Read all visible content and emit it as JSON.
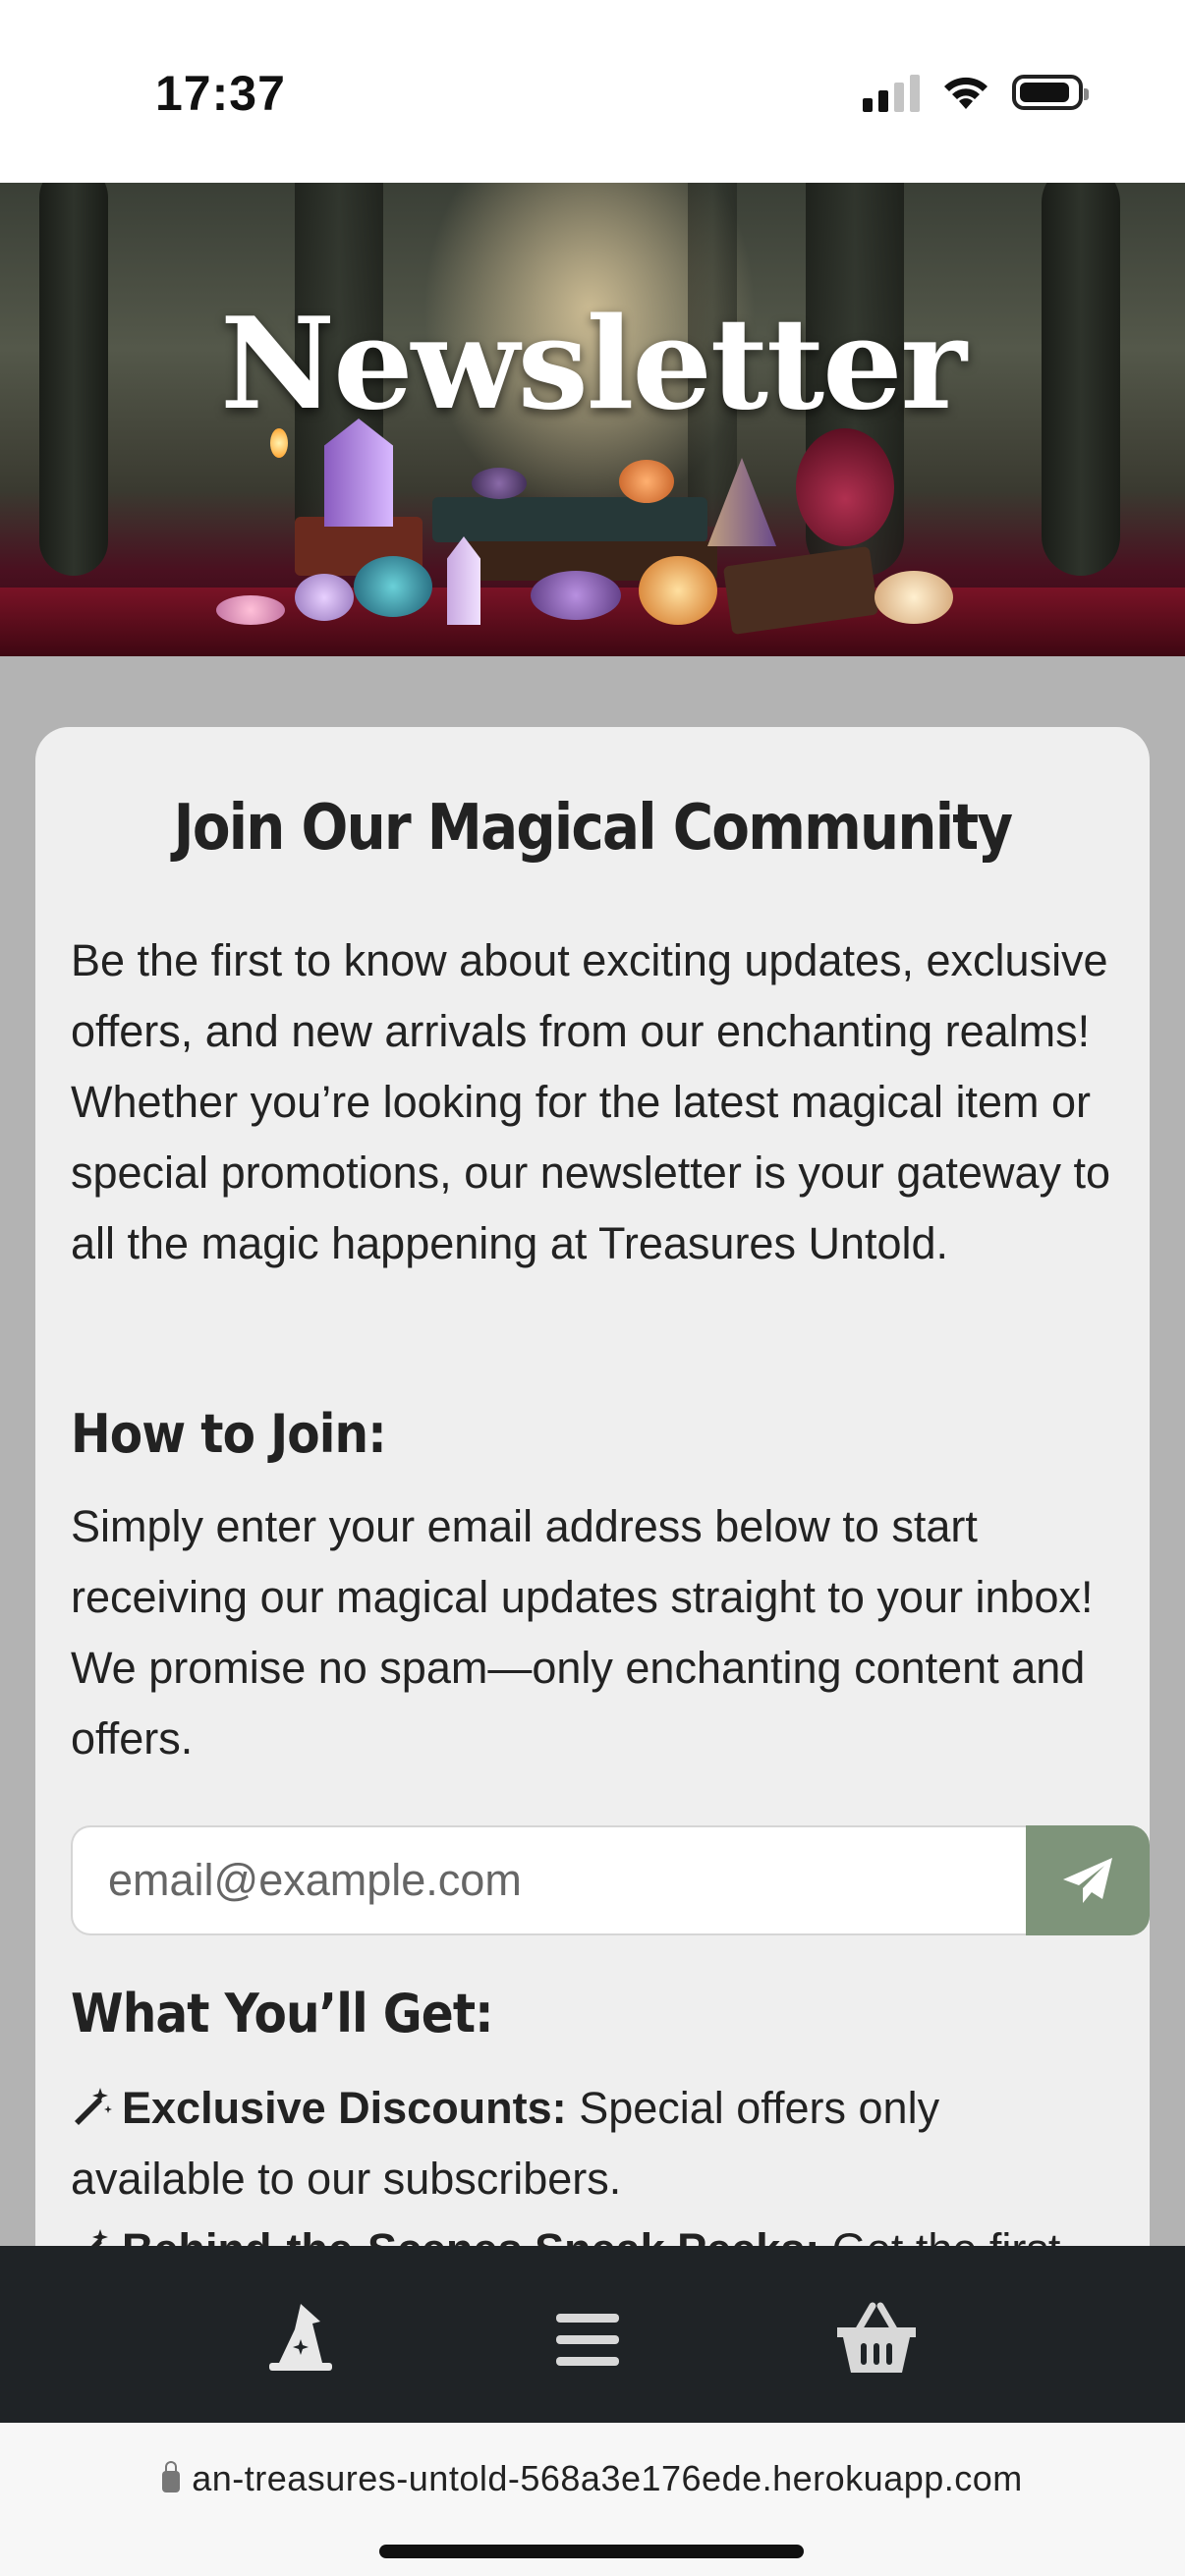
{
  "status_bar": {
    "time": "17:37"
  },
  "hero": {
    "title": "Newsletter"
  },
  "card": {
    "title": "Join Our Magical Community",
    "intro": "Be the first to know about exciting updates, exclusive offers, and new arrivals from our enchanting realms! Whether you’re looking for the latest magical item or special promotions, our newsletter is your gateway to all the magic happening at Treasures Untold.",
    "how_heading": "How to Join:",
    "how_text": "Simply enter your email address below to start receiving our magical updates straight to your inbox! We promise no spam—only enchanting content and offers.",
    "email_placeholder": "email@example.com",
    "get_heading": "What You’ll Get:",
    "benefits": [
      {
        "title": "Exclusive Discounts:",
        "text": "Special offers only available to our subscribers."
      },
      {
        "title": "Behind-the-Scenes Sneak Peeks:",
        "text": "Get the first"
      }
    ]
  },
  "bottom_nav": {
    "items": [
      {
        "icon": "wizard-hat-icon"
      },
      {
        "icon": "menu-icon"
      },
      {
        "icon": "basket-icon"
      }
    ]
  },
  "url_bar": {
    "url": "an-treasures-untold-568a3e176ede.herokuapp.com"
  },
  "colors": {
    "accent": "#7e947a",
    "nav_bg": "#1f2326",
    "card_bg": "#efefef",
    "page_bg": "#b3b3b3"
  }
}
